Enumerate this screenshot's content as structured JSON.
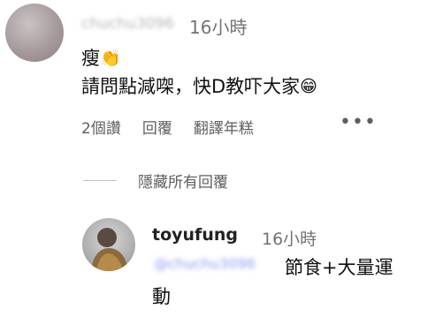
{
  "comment": {
    "username": "chuchu3096",
    "time": "16小時",
    "line1": "瘦",
    "line1_emoji": "👏",
    "line2": "請問點減㗎，快D教吓大家",
    "line2_emoji": "😁",
    "likes": "2個讚",
    "reply_label": "回覆",
    "translate_label": "翻譯年糕",
    "more": "•••"
  },
  "replies_toggle": {
    "label": "隱藏所有回覆"
  },
  "reply": {
    "username": "toyufung",
    "time": "16小時",
    "mention": "@chuchu3096",
    "text_line1": "節食+大量運",
    "text_line2": "動"
  }
}
